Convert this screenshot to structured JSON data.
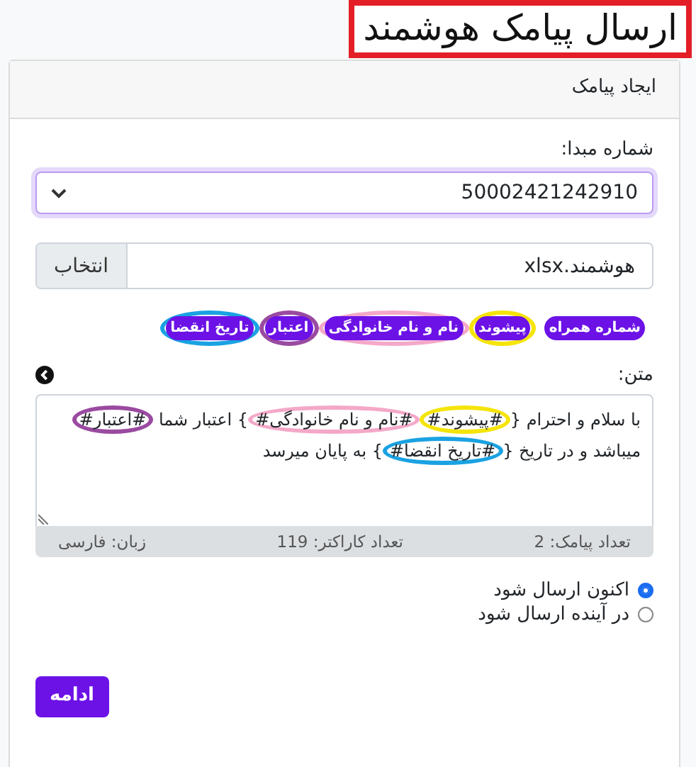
{
  "page_title": "ارسال پیامک هوشمند",
  "card": {
    "header": "ایجاد پیامک",
    "sender": {
      "label": "شماره مبدا:",
      "value": "50002421242910"
    },
    "file": {
      "value": "هوشمند.xlsx",
      "button": "انتخاب"
    },
    "tags": [
      {
        "label": "شماره همراه"
      },
      {
        "label": "پیشوند",
        "color": "#f5e40a"
      },
      {
        "label": "نام و نام خانوادگی",
        "color": "#f4a8c8"
      },
      {
        "label": "اعتبار",
        "color": "#9a4aa0"
      },
      {
        "label": "تاریخ انقضا",
        "color": "#1aa2e2"
      }
    ],
    "message": {
      "label": "متن:",
      "segments": [
        {
          "text": "با سلام و احترام {"
        },
        {
          "text": "#پیشوند#",
          "color": "#f5e40a"
        },
        {
          "text": "#نام و نام خانوادگی#",
          "color": "#f4a8c8"
        },
        {
          "text": "} اعتبار شما "
        },
        {
          "text": "#اعتبار#",
          "color": "#9a4aa0"
        },
        {
          "text": " میباشد و در تاریخ {"
        },
        {
          "text": "#تاریخ انقضا#",
          "color": "#1aa2e2"
        },
        {
          "text": "} به پایان میرسد"
        }
      ],
      "stats": [
        "تعداد پیامک: 2",
        "تعداد کاراکتر: 119",
        "زبان: فارسی"
      ]
    },
    "send_options": [
      {
        "label": "اکنون ارسال شود",
        "selected": true
      },
      {
        "label": "در آینده ارسال شود",
        "selected": false
      }
    ],
    "submit": "ادامه"
  }
}
